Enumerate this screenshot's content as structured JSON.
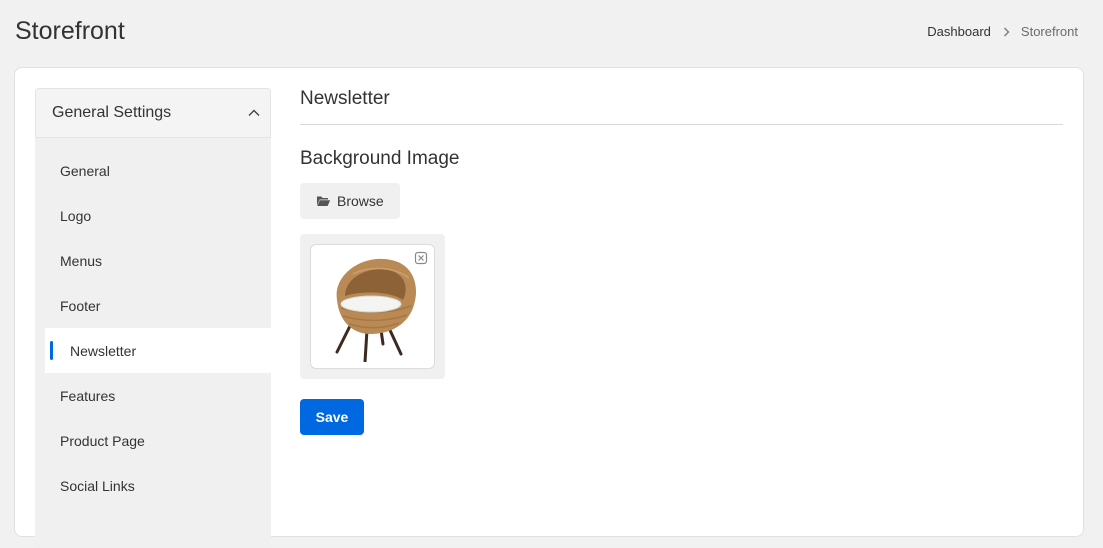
{
  "page": {
    "title": "Storefront"
  },
  "breadcrumb": {
    "items": [
      "Dashboard",
      "Storefront"
    ]
  },
  "sidebar": {
    "header": "General Settings",
    "header_icon": "chevron-up-icon",
    "items": [
      {
        "label": "General",
        "active": false
      },
      {
        "label": "Logo",
        "active": false
      },
      {
        "label": "Menus",
        "active": false
      },
      {
        "label": "Footer",
        "active": false
      },
      {
        "label": "Newsletter",
        "active": true
      },
      {
        "label": "Features",
        "active": false
      },
      {
        "label": "Product Page",
        "active": false
      },
      {
        "label": "Social Links",
        "active": false
      }
    ]
  },
  "content": {
    "section_title": "Newsletter",
    "field_title": "Background Image",
    "browse_label": "Browse",
    "browse_icon": "folder-open-icon",
    "image": {
      "depicts": "wicker-egg-chair",
      "remove_icon": "remove-image-icon"
    },
    "save_label": "Save"
  },
  "colors": {
    "accent": "#0068e1",
    "page_background": "#f1f1f1",
    "sidebar_background": "#f0f0f0"
  }
}
